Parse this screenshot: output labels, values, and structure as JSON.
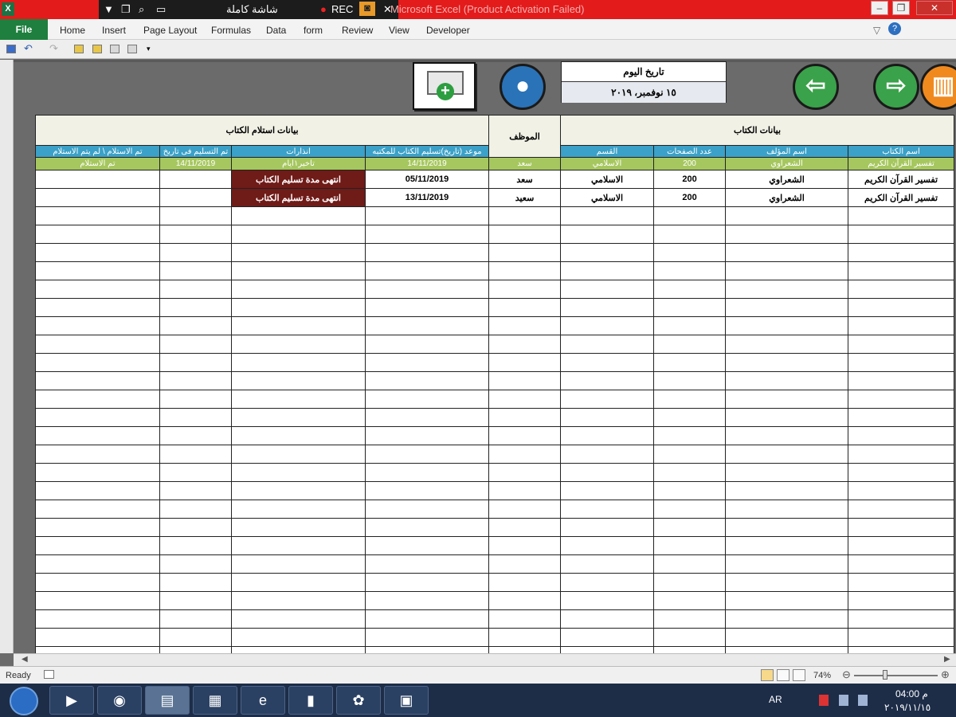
{
  "window": {
    "app_icon": "X",
    "title": "Microsoft Excel (Product Activation Failed)",
    "recorder": {
      "label": "شاشة كاملة",
      "rec": "REC",
      "close": "✕"
    },
    "controls": [
      "–",
      "❐",
      "✕"
    ]
  },
  "ribbon": {
    "file": "File",
    "tabs": [
      "Home",
      "Insert",
      "Page Layout",
      "Formulas",
      "Data",
      "form",
      "Review",
      "View",
      "Developer"
    ]
  },
  "header_panel": {
    "date_label": "تاريخ اليوم",
    "date_value": "١٥ نوفمبر، ٢٠١٩"
  },
  "table": {
    "groups": {
      "receipt": "بيانات استلام الكتاب",
      "employee": "الموظف",
      "book": "بيانات الكتاب"
    },
    "columns": [
      "تم الاستلام \\ لم يتم الاستلام",
      "تم التسليم فى تاريخ",
      "انذارات",
      "موعد (تاريخ)تسليم الكتاب للمكتبه",
      "",
      "القسم",
      "عدد الصفحات",
      "اسم المؤلف",
      "اسم الكتاب"
    ],
    "rows": [
      [
        "تم الاستلام",
        "14/11/2019",
        "تاخير١ايام",
        "14/11/2019",
        "سعد",
        "الاسلامي",
        "200",
        "الشعراوي",
        "تفسير القرآن الكريم"
      ],
      [
        "",
        "",
        "انتهى مدة تسليم الكتاب",
        "05/11/2019",
        "سعد",
        "الاسلامي",
        "200",
        "الشعراوي",
        "تفسير القرآن الكريم"
      ],
      [
        "",
        "",
        "انتهى مدة تسليم الكتاب",
        "13/11/2019",
        "سعيد",
        "الاسلامي",
        "200",
        "الشعراوي",
        "تفسير القرآن الكريم"
      ]
    ],
    "empty_rows": 25
  },
  "status": {
    "ready": "Ready",
    "zoom": "74%"
  },
  "taskbar": {
    "lang": "AR",
    "time": "04:00 م",
    "date": "٢٠١٩/١١/١٥"
  },
  "colors": {
    "title_bar": "#e31b1b",
    "header_blue": "#3ba1c8",
    "row_green": "#a6c75f",
    "warning_red": "#6f1b18",
    "sheet_bg": "#6b6b6b"
  }
}
